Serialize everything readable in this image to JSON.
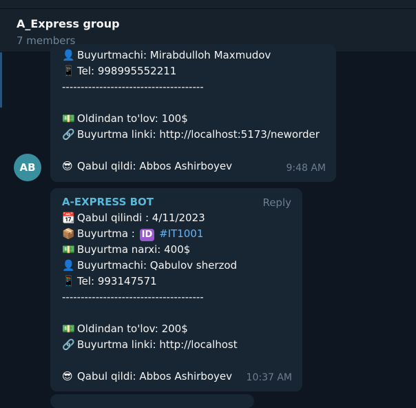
{
  "chat": {
    "title": "A_Express group",
    "members": "7 members"
  },
  "avatar": {
    "initials": "AB"
  },
  "message1": {
    "customer": "Buyurtmachi: Mirabdulloh Maxmudov",
    "phone": "Tel: 998995552211",
    "separator": "--------------------------------------",
    "prepay": "Oldindan to'lov: 100$",
    "link": "Buyurtma linki:  http://localhost:5173/neworder",
    "accepted": "Qabul qildi: Abbos Ashirboyev",
    "time": "9:48 AM"
  },
  "message2": {
    "sender": "A-EXPRESS BOT",
    "reply_label": "Reply",
    "received": "Qabul qilindi : 4/11/2023",
    "order_label": "Buyurtma :",
    "id_badge": "ID",
    "order_hashtag": "#IT1001",
    "price": "Buyurtma narxi: 400$",
    "customer": "Buyurtmachi: Qabulov sherzod",
    "phone": "Tel: 993147571",
    "separator": "--------------------------------------",
    "prepay": "Oldindan to'lov: 200$",
    "link": "Buyurtma linki:  http://localhost",
    "accepted": "Qabul qildi: Abbos Ashirboyev",
    "time": "10:37 AM"
  },
  "icons": {
    "person": "👤",
    "phone": "📱",
    "money": "💵",
    "link": "🔗",
    "cool": "😎",
    "calendar": "📆",
    "package": "📦"
  },
  "colors": {
    "background": "#0e1621",
    "bubble": "#182533",
    "header": "#17212b",
    "sender": "#58b8d9",
    "hashtag": "#6ab3f3",
    "meta": "#6d7f8f"
  }
}
